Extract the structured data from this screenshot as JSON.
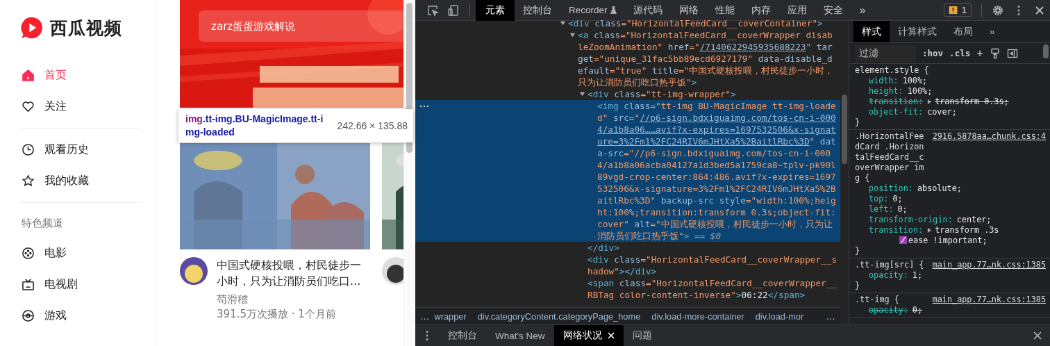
{
  "page": {
    "logo": {
      "text": "西瓜视频"
    },
    "nav_groups": [
      [
        {
          "label": "首页",
          "selected": true
        },
        {
          "label": "关注",
          "selected": false
        }
      ],
      [
        {
          "label": "观看历史",
          "selected": false
        },
        {
          "label": "我的收藏",
          "selected": false
        }
      ]
    ],
    "channels_heading": "特色频道",
    "channels": [
      {
        "label": "电影",
        "selected": false
      },
      {
        "label": "电视剧",
        "selected": false
      },
      {
        "label": "游戏",
        "selected": false
      }
    ],
    "search": {
      "placeholder": "zarz蛋蛋游戏解说"
    },
    "inspect_tooltip": {
      "tag": "img",
      "classes": ".tt-img.BU-MagicImage.tt-img-loaded",
      "size": "242.66 × 135.88"
    },
    "cards": [
      {
        "title": "中国式硬核投喂，村民徒步一小时，只为让消防员们吃口...",
        "author": "苟滑稽",
        "meta": "391.5万次播放 · 1个月前"
      }
    ]
  },
  "devtools": {
    "tabs": [
      {
        "label": "元素",
        "selected": true
      },
      {
        "label": "控制台",
        "selected": false
      },
      {
        "label": "Recorder",
        "selected": false,
        "kind": "experimental"
      },
      {
        "label": "源代码",
        "selected": false
      },
      {
        "label": "网络",
        "selected": false
      },
      {
        "label": "性能",
        "selected": false
      },
      {
        "label": "内存",
        "selected": false
      },
      {
        "label": "应用",
        "selected": false
      },
      {
        "label": "安全",
        "selected": false
      }
    ],
    "tabs_more": "»",
    "issues_count": "1",
    "elements": {
      "nodes": [
        {
          "expanded": true,
          "selected": false,
          "tokens": [
            {
              "kind": "tag",
              "text": "<div"
            },
            {
              "kind": "attr",
              "text": " class"
            },
            {
              "kind": "value",
              "text": "=\"HorizontalFeedCard__coverContainer\""
            },
            {
              "kind": "tag",
              "text": ">"
            }
          ],
          "children": [
            {
              "expanded": true,
              "selected": false,
              "tokens": [
                {
                  "kind": "tag",
                  "text": "<a"
                },
                {
                  "kind": "attr",
                  "text": " class"
                },
                {
                  "kind": "value",
                  "text": "=\"HorizontalFeedCard__coverWrapper disableZoomAnimation\""
                },
                {
                  "kind": "attr",
                  "text": " href"
                },
                {
                  "kind": "value",
                  "text": "=\""
                },
                {
                  "kind": "link",
                  "text": "/7140622945935688223"
                },
                {
                  "kind": "value",
                  "text": "\""
                },
                {
                  "kind": "attr",
                  "text": " target"
                },
                {
                  "kind": "value",
                  "text": "=\"unique_31fac5bb89ecd6927179\""
                },
                {
                  "kind": "attr",
                  "text": " data-disable_default"
                },
                {
                  "kind": "value",
                  "text": "=\"true\""
                },
                {
                  "kind": "attr",
                  "text": " title"
                },
                {
                  "kind": "value",
                  "text": "=\"中国式硬核投喂，村民徒步一小时，只为让消防员们吃口热乎饭\""
                },
                {
                  "kind": "tag",
                  "text": ">"
                }
              ],
              "children": [
                {
                  "expanded": true,
                  "selected": false,
                  "close": "</div>",
                  "tokens": [
                    {
                      "kind": "tag",
                      "text": "<div"
                    },
                    {
                      "kind": "attr",
                      "text": " class"
                    },
                    {
                      "kind": "value",
                      "text": "=\"tt-img-wrapper\""
                    },
                    {
                      "kind": "tag",
                      "text": ">"
                    }
                  ],
                  "children": [
                    {
                      "selected": true,
                      "tokens": [
                        {
                          "kind": "tag",
                          "text": "<img"
                        },
                        {
                          "kind": "attr",
                          "text": " class"
                        },
                        {
                          "kind": "value",
                          "text": "=\"tt-img BU-MagicImage tt-img-loaded\""
                        },
                        {
                          "kind": "attr",
                          "text": " src"
                        },
                        {
                          "kind": "value",
                          "text": "=\""
                        },
                        {
                          "kind": "link",
                          "text": "//p6-sign.bdxiguaimg.com/tos-cn-i-0004/a1b8a06……avif?x-expires=1697532506&x-signature=3%2Fm1%2FC24RIV6mJHtXa5%2BaitlRbc%3D"
                        },
                        {
                          "kind": "value",
                          "text": "\""
                        },
                        {
                          "kind": "attr",
                          "text": " data-src"
                        },
                        {
                          "kind": "value",
                          "text": "=\"//p6-sign.bdxiguaimg.com/tos-cn-i-0004/a1b8a06acba04127a1d3bed5a1759ca8~tplv-pk90l89vgd-crop-center:864:486.avif?x-expires=1697532506&x-signature=3%2Fm1%2FC24RIV6mJHtXa5%2BaitlRbc%3D\""
                        },
                        {
                          "kind": "attr",
                          "text": " backup-src"
                        },
                        {
                          "kind": "attr",
                          "text": " style"
                        },
                        {
                          "kind": "value",
                          "text": "=\"width:100%;height:100%;transition:transform 0.3s;object-fit:cover\""
                        },
                        {
                          "kind": "attr",
                          "text": " alt"
                        },
                        {
                          "kind": "value",
                          "text": "=\"中国式硬核投喂，村民徒步一小时，只为让消防员们吃口热乎饭\""
                        },
                        {
                          "kind": "tag",
                          "text": ">"
                        },
                        {
                          "kind": "hint",
                          "text": " == $0"
                        }
                      ]
                    }
                  ]
                },
                {
                  "selected": false,
                  "tokens": [
                    {
                      "kind": "tag",
                      "text": "<div"
                    },
                    {
                      "kind": "attr",
                      "text": " class"
                    },
                    {
                      "kind": "value",
                      "text": "=\"HorizontalFeedCard__coverWrapper__shadow\""
                    },
                    {
                      "kind": "tag",
                      "text": "></div>"
                    }
                  ]
                },
                {
                  "selected": false,
                  "tokens": [
                    {
                      "kind": "tag",
                      "text": "<span"
                    },
                    {
                      "kind": "attr",
                      "text": " class"
                    },
                    {
                      "kind": "value",
                      "text": "=\"HorizontalFeedCard__coverWrapper__RBTag color-content-inverse\""
                    },
                    {
                      "kind": "tag",
                      "text": ">"
                    },
                    {
                      "kind": "text",
                      "text": "06:22"
                    },
                    {
                      "kind": "tag",
                      "text": "</span>"
                    }
                  ]
                }
              ]
            }
          ]
        }
      ]
    },
    "breadcrumbs": {
      "scroll_left": "…",
      "items": [
        {
          "label": "wrapper",
          "selected": false
        },
        {
          "label": "div.categoryContent.categoryPage_home",
          "selected": false
        },
        {
          "label": "div.load-more-container",
          "selected": false
        },
        {
          "label": "div.load-mor",
          "selected": false
        }
      ],
      "scroll_right": "…"
    },
    "styles": {
      "tabs": [
        {
          "label": "样式",
          "selected": true
        },
        {
          "label": "计算样式",
          "selected": false
        },
        {
          "label": "布局",
          "selected": false
        }
      ],
      "tabs_more": "»",
      "filter": {
        "placeholder": "过滤"
      },
      "hov": ":hov",
      "cls": ".cls",
      "add": "+",
      "rules": [
        {
          "selector": "element.style {",
          "props": [
            {
              "name": "width:",
              "value": "100%;",
              "overridden": false
            },
            {
              "name": "height:",
              "value": "100%;",
              "overridden": false
            },
            {
              "name": "transition:",
              "value": "transform 0.3s;",
              "overridden": true,
              "expandable": true
            },
            {
              "name": "object-fit:",
              "value": "cover;",
              "overridden": false
            }
          ],
          "close": "}"
        },
        {
          "selector": ".HorizontalFeedCard .HorizontalFeedCard__coverWrapper img {",
          "source": "2916.5878aa…chunk.css:4",
          "props": [
            {
              "name": "position:",
              "value": "absolute;",
              "overridden": false
            },
            {
              "name": "top:",
              "value": "0;",
              "overridden": false
            },
            {
              "name": "left:",
              "value": "0;",
              "overridden": false
            },
            {
              "name": "transform-origin:",
              "value": "center;",
              "overridden": false
            },
            {
              "name": "transition:",
              "value": "transform .3s",
              "overridden": false,
              "expandable": true,
              "easing": "ease !important;"
            }
          ],
          "close": "}"
        },
        {
          "selector": ".tt-img[src] {",
          "source": "main_app.77…nk.css:1385",
          "props": [
            {
              "name": "opacity:",
              "value": "1;",
              "overridden": false
            }
          ],
          "close": "}"
        },
        {
          "selector": ".tt-img {",
          "source": "main_app.77…nk.css:1385",
          "props": [
            {
              "name": "opacity:",
              "value": "0;",
              "overridden": true
            }
          ]
        }
      ]
    },
    "drawer_tabs": [
      {
        "label": "控制台",
        "selected": false
      },
      {
        "label": "What's New",
        "selected": false
      },
      {
        "label": "网络状况",
        "selected": true,
        "closable": true
      },
      {
        "label": "问题",
        "selected": false
      }
    ]
  }
}
